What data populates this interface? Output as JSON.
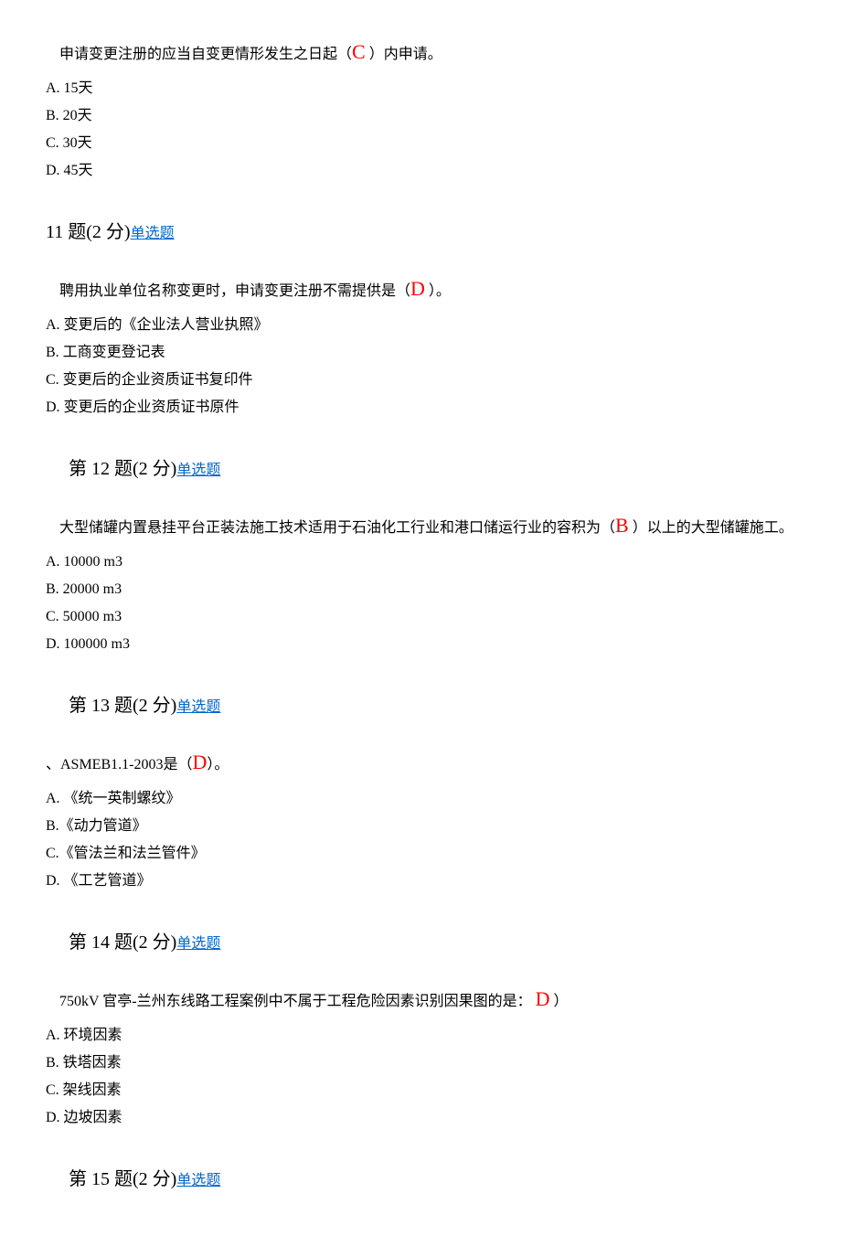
{
  "q10": {
    "text_before": "申请变更注册的应当自变更情形发生之日起（",
    "answer": "C",
    "text_after": " ）内申请。",
    "options": {
      "a": "A. 15天",
      "b": "B. 20天",
      "c": "C. 30天",
      "d": "D. 45天"
    }
  },
  "q11": {
    "header": "11 题(2 分)",
    "type": "单选题",
    "text_before": "聘用执业单位名称变更时，申请变更注册不需提供是（",
    "answer": "D",
    "text_after": " ）。",
    "options": {
      "a": "A. 变更后的《企业法人营业执照》",
      "b": "B. 工商变更登记表",
      "c": "C. 变更后的企业资质证书复印件",
      "d": "D. 变更后的企业资质证书原件"
    }
  },
  "q12": {
    "header": "第 12 题(2 分)",
    "type": "单选题",
    "text_before": "大型储罐内置悬挂平台正装法施工技术适用于石油化工行业和港口储运行业的容积为（",
    "answer": "B",
    "text_after": " ）以上的大型储罐施工。",
    "options": {
      "a": "A. 10000 m3",
      "b": "B. 20000 m3",
      "c": "C. 50000 m3",
      "d": "D.  100000 m3"
    }
  },
  "q13": {
    "header": "第 13 题(2 分)",
    "type": "单选题",
    "text_before": "、ASMEB1.1-2003是（",
    "answer": "D",
    "text_after": "）。",
    "options": {
      "a": "A. 《统一英制螺纹》",
      "b": "B.《动力管道》",
      "c": "C.《管法兰和法兰管件》",
      "d": "D. 《工艺管道》"
    }
  },
  "q14": {
    "header": "第 14 题(2 分)",
    "type": "单选题",
    "text_before": "750kV 官亭-兰州东线路工程案例中不属于工程危险因素识别因果图的是： ",
    "answer": "D",
    "text_after": "  ）",
    "options": {
      "a": "A. 环境因素",
      "b": "B. 铁塔因素",
      "c": "C. 架线因素",
      "d": "D. 边坡因素"
    }
  },
  "q15": {
    "header": "第 15 题(2 分)",
    "type": "单选题"
  }
}
